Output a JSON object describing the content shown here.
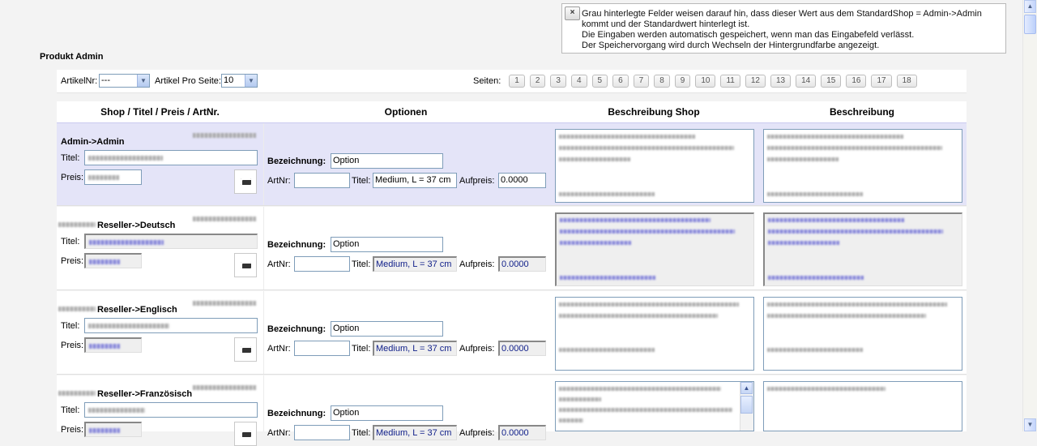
{
  "notice": {
    "close_label": "×",
    "lines": [
      "Grau hinterlegte Felder weisen darauf hin, dass dieser Wert aus dem StandardShop = Admin->Admin",
      "kommt und der Standardwert hinterlegt ist.",
      "Die Eingaben werden automatisch gespeichert, wenn man das Eingabefeld verlässt.",
      "Der Speichervorgang wird durch Wechseln der Hintergrundfarbe angezeigt."
    ]
  },
  "page_title": "Produkt Admin",
  "toolbar": {
    "artikelnr_label": "ArtikelNr:",
    "artikelnr_value": "---",
    "pro_seite_label": "Artikel Pro Seite:",
    "pro_seite_value": "10",
    "pages_label": "Seiten:",
    "pages": [
      "1",
      "2",
      "3",
      "4",
      "5",
      "6",
      "7",
      "8",
      "9",
      "10",
      "11",
      "12",
      "13",
      "14",
      "15",
      "16",
      "17",
      "18"
    ]
  },
  "columns": {
    "shop": "Shop / Titel / Preis / ArtNr.",
    "optionen": "Optionen",
    "beschreibung_shop": "Beschreibung Shop",
    "beschreibung": "Beschreibung"
  },
  "labels": {
    "titel": "Titel:",
    "preis": "Preis:",
    "bezeichnung": "Bezeichnung:",
    "artnr": "ArtNr:",
    "opt_titel": "Titel:",
    "aufpreis": "Aufpreis:"
  },
  "rows": [
    {
      "shop": "Admin->Admin",
      "bezeichnung": "Option",
      "artnr": "",
      "opt_titel": "Medium, L = 37 cm",
      "aufpreis": "0.0000"
    },
    {
      "shop": "Reseller->Deutsch",
      "bezeichnung": "Option",
      "artnr": "",
      "opt_titel": "Medium, L = 37 cm",
      "aufpreis": "0.0000"
    },
    {
      "shop": "Reseller->Englisch",
      "bezeichnung": "Option",
      "artnr": "",
      "opt_titel": "Medium, L = 37 cm",
      "aufpreis": "0.0000"
    },
    {
      "shop": "Reseller->Französisch",
      "bezeichnung": "Option",
      "artnr": "",
      "opt_titel": "Medium, L = 37 cm",
      "aufpreis": "0.0000"
    }
  ],
  "icons": {
    "close": "close-icon",
    "save": "save-icon",
    "scroll_up": "scroll-up-arrow-icon",
    "scroll_down": "scroll-down-arrow-icon"
  },
  "colors": {
    "active_row": "#e4e4f8",
    "inherited_field": "#efefef",
    "inherited_text": "#11208a",
    "input_border": "#7f9db9"
  }
}
